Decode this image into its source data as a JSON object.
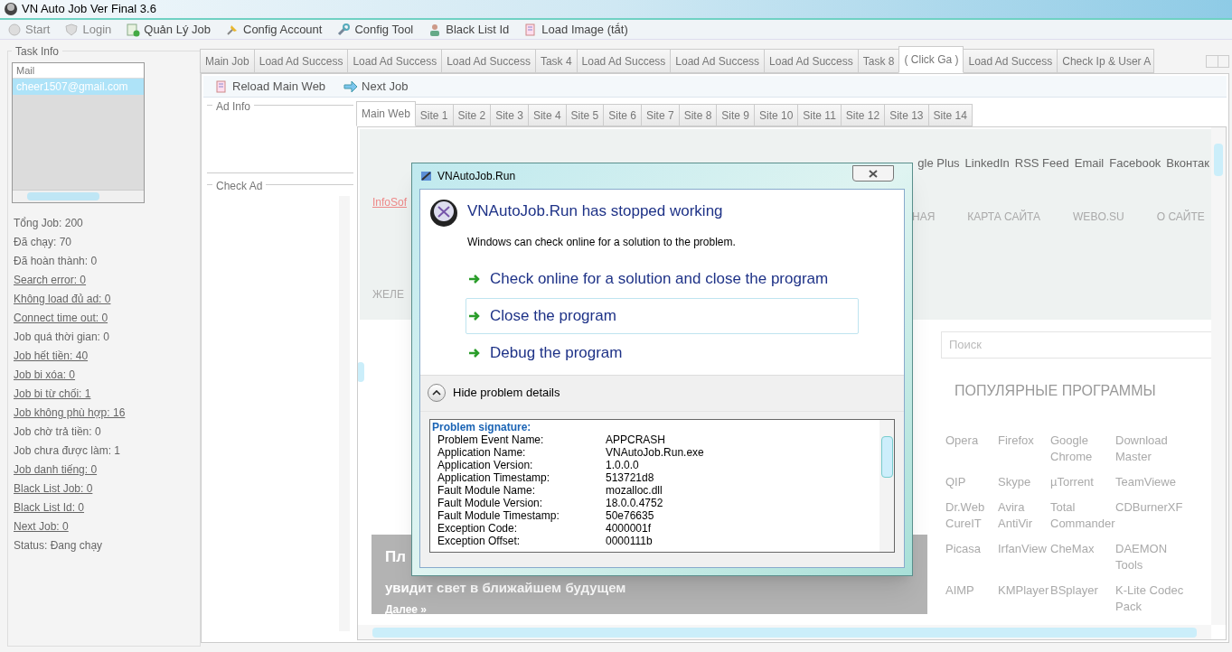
{
  "window": {
    "title": "VN Auto Job Ver Final 3.6"
  },
  "toolbar": [
    {
      "label": "Start",
      "disabled": true
    },
    {
      "label": "Login",
      "disabled": true
    },
    {
      "label": "Quản Lý Job",
      "disabled": false
    },
    {
      "label": "Config Account",
      "disabled": false
    },
    {
      "label": "Config Tool",
      "disabled": false
    },
    {
      "label": "Black List Id",
      "disabled": false
    },
    {
      "label": "Load Image (tắt)",
      "disabled": false
    }
  ],
  "task_info": {
    "title": "Task Info",
    "list_header": "Mail",
    "items": [
      {
        "label": "cheer1507@gmail.com",
        "selected": true
      }
    ],
    "stats": [
      {
        "text": "Tổng Job: 200",
        "link": false
      },
      {
        "text": "Đã chạy: 70",
        "link": false
      },
      {
        "text": "Đã hoàn thành: 0",
        "link": false
      },
      {
        "text": "Search error: 0",
        "link": true
      },
      {
        "text": "Không load đủ ad: 0",
        "link": true
      },
      {
        "text": "Connect time out: 0",
        "link": true
      },
      {
        "text": "Job quá thời gian: 0",
        "link": false
      },
      {
        "text": "Job hết tiền: 40",
        "link": true
      },
      {
        "text": "Job bi xóa: 0",
        "link": true
      },
      {
        "text": "Job bi từ chối: 1",
        "link": true
      },
      {
        "text": "Job không phù hợp: 16",
        "link": true
      },
      {
        "text": "Job chờ trả tiền: 0",
        "link": false
      },
      {
        "text": "Job chưa được làm: 1",
        "link": false
      },
      {
        "text": "Job danh tiếng: 0",
        "link": true
      },
      {
        "text": "Black List Job: 0",
        "link": true
      },
      {
        "text": "Black List Id: 0",
        "link": true
      },
      {
        "text": "Next Job: 0",
        "link": true
      },
      {
        "text": "Status: Đang chạy",
        "link": false
      }
    ]
  },
  "tabs": [
    {
      "label": "Main Job",
      "selected": false
    },
    {
      "label": "Load Ad Success",
      "selected": false
    },
    {
      "label": "Load Ad Success",
      "selected": false
    },
    {
      "label": "Load Ad Success",
      "selected": false
    },
    {
      "label": "Task 4",
      "selected": false
    },
    {
      "label": "Load Ad Success",
      "selected": false
    },
    {
      "label": "Load Ad Success",
      "selected": false
    },
    {
      "label": "Load Ad Success",
      "selected": false
    },
    {
      "label": "Task 8",
      "selected": false
    },
    {
      "label": "( Click Ga )",
      "selected": true
    },
    {
      "label": "Load Ad Success",
      "selected": false
    },
    {
      "label": "Check Ip & User A",
      "selected": false
    }
  ],
  "tab_toolbar": [
    "Reload Main Web",
    "Next Job"
  ],
  "ad_info": {
    "title": "Ad Info"
  },
  "check_ad": {
    "title": "Check Ad"
  },
  "site_tabs": [
    {
      "label": "Main Web",
      "selected": true
    },
    {
      "label": "Site 1",
      "selected": false
    },
    {
      "label": "Site 2",
      "selected": false
    },
    {
      "label": "Site 3",
      "selected": false
    },
    {
      "label": "Site 4",
      "selected": false
    },
    {
      "label": "Site 5",
      "selected": false
    },
    {
      "label": "Site 6",
      "selected": false
    },
    {
      "label": "Site 7",
      "selected": false
    },
    {
      "label": "Site 8",
      "selected": false
    },
    {
      "label": "Site 9",
      "selected": false
    },
    {
      "label": "Site 10",
      "selected": false
    },
    {
      "label": "Site 11",
      "selected": false
    },
    {
      "label": "Site 12",
      "selected": false
    },
    {
      "label": "Site 13",
      "selected": false
    },
    {
      "label": "Site 14",
      "selected": false
    }
  ],
  "web": {
    "social_links": [
      "gle Plus",
      "LinkedIn",
      "RSS Feed",
      "Email",
      "Facebook",
      "Вконтак"
    ],
    "logo_link": "InfoSof",
    "nav": [
      "НАЯ",
      "КАРТА САЙТА",
      "WEBO.SU",
      "О САЙТЕ"
    ],
    "menu_item": "ЖЕЛЕ",
    "search": {
      "placeholder": "Поиск"
    },
    "popular_title": "ПОПУЛЯРНЫЕ ПРОГРАММЫ",
    "programs": [
      "Opera",
      "Firefox",
      "Google Chrome",
      "Download Master",
      "QIP",
      "Skype",
      "µTorrent",
      "TeamViewe",
      "Dr.Web CureIT",
      "Avira AntiVir",
      "Total Commander",
      "CDBurnerXF",
      "Picasa",
      "IrfanView",
      "CheMax",
      "DAEMON Tools",
      "AIMP",
      "KMPlayer",
      "BSplayer",
      "K-Lite Codec Pack"
    ],
    "banner": {
      "title": "Пл",
      "subtitle": "увидит свет в ближайшем будущем",
      "link": "Далее »"
    }
  },
  "dialog": {
    "title": "VNAutoJob.Run",
    "heading": "VNAutoJob.Run has stopped working",
    "message": "Windows can check online for a solution to the problem.",
    "options": [
      {
        "label": "Check online for a solution and close the program",
        "selected": false
      },
      {
        "label": "Close the program",
        "selected": true
      },
      {
        "label": "Debug the program",
        "selected": false
      }
    ],
    "details_toggle": "Hide problem details",
    "details_title": "Problem signature:",
    "details": [
      {
        "key": "Problem Event Name:",
        "value": "APPCRASH"
      },
      {
        "key": "Application Name:",
        "value": "VNAutoJob.Run.exe"
      },
      {
        "key": "Application Version:",
        "value": "1.0.0.0"
      },
      {
        "key": "Application Timestamp:",
        "value": "513721d8"
      },
      {
        "key": "Fault Module Name:",
        "value": "mozalloc.dll"
      },
      {
        "key": "Fault Module Version:",
        "value": "18.0.0.4752"
      },
      {
        "key": "Fault Module Timestamp:",
        "value": "50e76635"
      },
      {
        "key": "Exception Code:",
        "value": "4000001f"
      },
      {
        "key": "Exception Offset:",
        "value": "0000111b"
      }
    ]
  }
}
